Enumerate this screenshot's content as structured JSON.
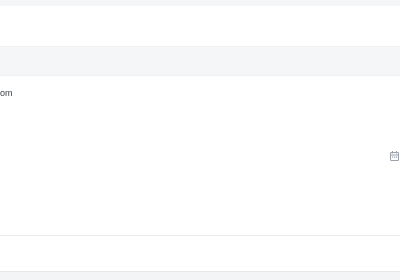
{
  "contact": {
    "email_fragment": "om"
  },
  "icons": {
    "date_picker": "calendar-icon"
  },
  "colors": {
    "band_background": "#f5f6f8",
    "divider": "#e9ebef",
    "text": "#3a3f45",
    "icon": "#9aa1ab"
  }
}
